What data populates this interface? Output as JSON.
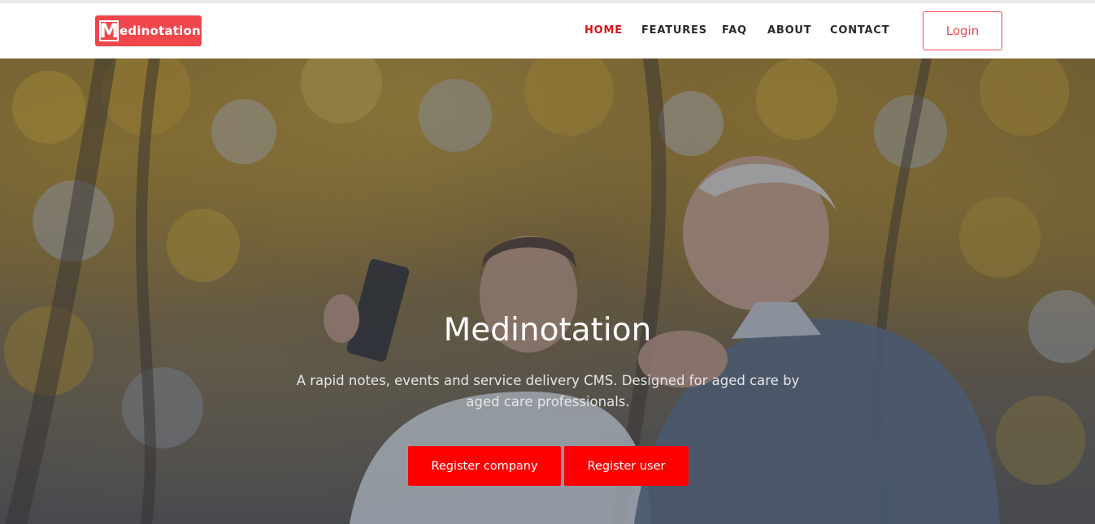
{
  "header": {
    "logo_initial": "M",
    "logo_rest": "edinotation",
    "nav": [
      {
        "label": "HOME",
        "active": true
      },
      {
        "label": "FEATURES",
        "active": false
      },
      {
        "label": "FAQ",
        "active": false
      },
      {
        "label": "ABOUT",
        "active": false
      },
      {
        "label": "CONTACT",
        "active": false
      }
    ],
    "login_label": "Login"
  },
  "hero": {
    "title": "Medinotation",
    "subtitle": "A rapid notes, events and service delivery CMS. Designed for aged care by aged care professionals.",
    "buttons": {
      "register_company": "Register company",
      "register_user": "Register user"
    }
  },
  "colors": {
    "brand": "#f0464c",
    "nav_active": "#d81418",
    "cta": "#ff0000"
  }
}
